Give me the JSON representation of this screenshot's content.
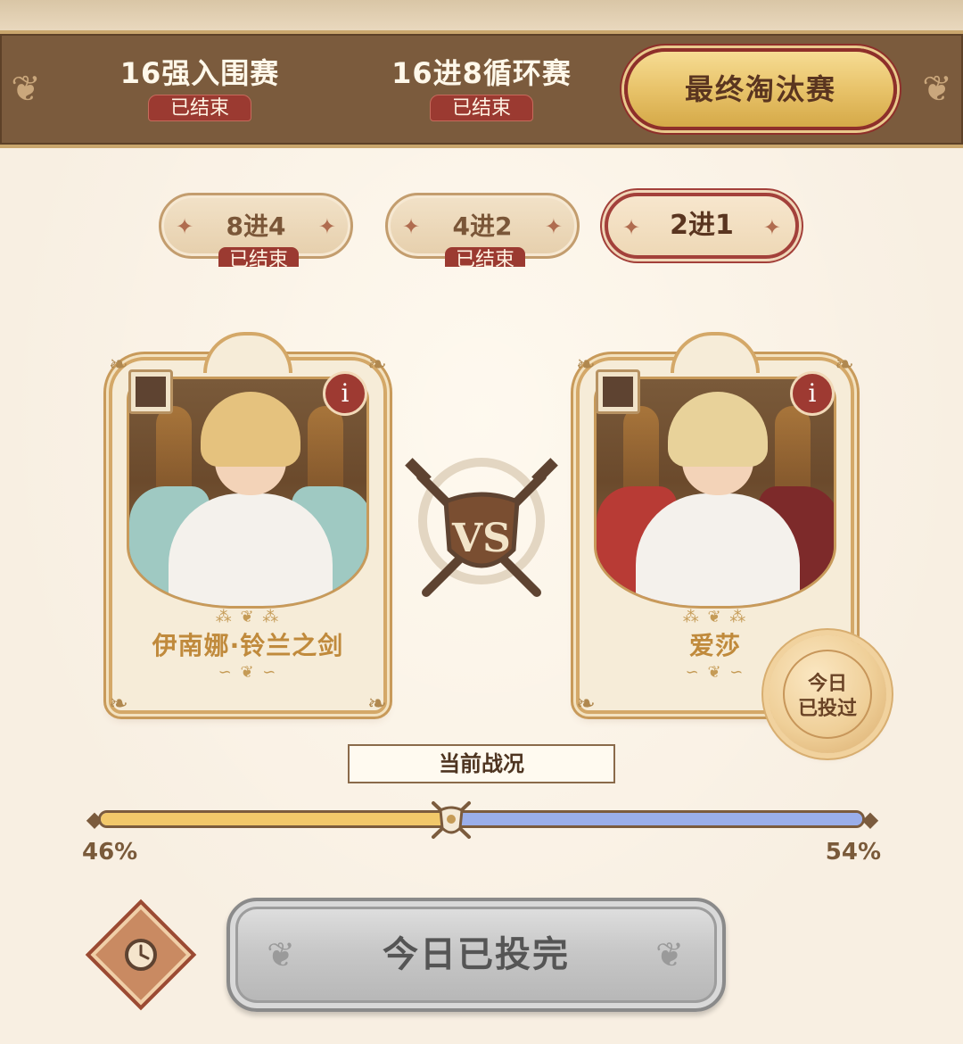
{
  "stages": [
    {
      "title": "16强入围赛",
      "status": "已结束"
    },
    {
      "title": "16进8循环赛",
      "status": "已结束"
    },
    {
      "title": "最终淘汰赛",
      "status": ""
    }
  ],
  "rounds": [
    {
      "label": "8进4",
      "status": "已结束"
    },
    {
      "label": "4进2",
      "status": "已结束"
    },
    {
      "label": "2进1",
      "status": ""
    }
  ],
  "matchup": {
    "left": {
      "name": "伊南娜·铃兰之剑"
    },
    "right": {
      "name": "爱莎"
    },
    "vs_label": "VS",
    "voted_seal": {
      "line1": "今日",
      "line2": "已投过"
    }
  },
  "battle_status": {
    "title": "当前战况",
    "left_percent": 46,
    "right_percent": 54,
    "left_label": "46%",
    "right_label": "54%"
  },
  "vote_button": {
    "label": "今日已投完"
  },
  "colors": {
    "left_bar": "#f2c86a",
    "right_bar": "#9aaeea",
    "accent_red": "#9b3a31",
    "frame_brown": "#7b5b3d",
    "gold": "#e8c36a"
  },
  "icons": {
    "info": "i",
    "clock": "clock-icon",
    "vs": "crossed-swords-shield-icon"
  }
}
